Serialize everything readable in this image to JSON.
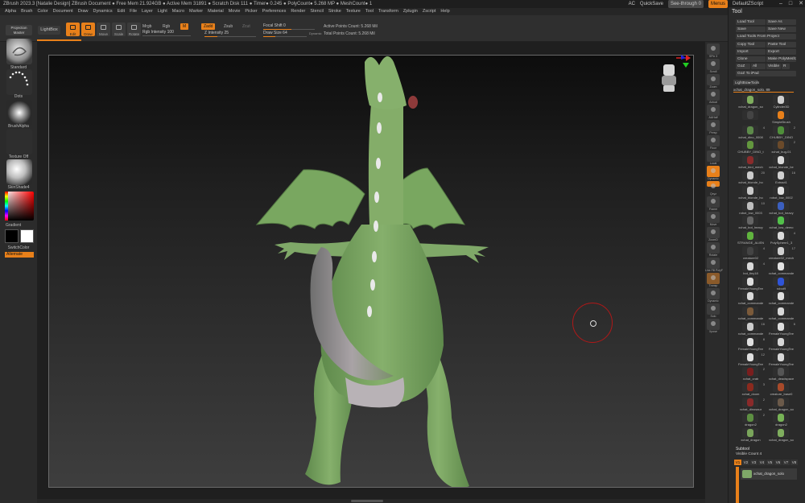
{
  "title_bar": {
    "title": "ZBrush 2023.3 [Natalie Design]   ZBrush Document     ● Free Mem 21.924GB ● Active Mem 31891 ● Scratch Disk 111 ● Timer● 0.245 ● PolyCount● 5.268 MP ● MeshCount● 1",
    "ac": "AC",
    "quicksave": "QuickSave",
    "see_through": "See-through  0",
    "menus": "Menus",
    "default_script": "DefaultZScript",
    "minimize": "–",
    "maximize": "□",
    "close": "✕"
  },
  "menu_bar": [
    "Alpha",
    "Brush",
    "Color",
    "Document",
    "Draw",
    "Dynamics",
    "Edit",
    "File",
    "Layer",
    "Light",
    "Macro",
    "Marker",
    "Material",
    "Movie",
    "Picker",
    "Preferences",
    "Render",
    "Stencil",
    "Stroke",
    "Texture",
    "Tool",
    "Transform",
    "Zplugin",
    "Zscript",
    "Help"
  ],
  "top_shelf": {
    "lightbox": "LightBox",
    "buttons": [
      {
        "label": "Edit",
        "active": true,
        "icon": "edit-icon"
      },
      {
        "label": "Draw",
        "active": true,
        "icon": "draw-icon"
      },
      {
        "label": "Move",
        "active": false,
        "icon": "move-icon"
      },
      {
        "label": "Scale",
        "active": false,
        "icon": "scale-icon"
      },
      {
        "label": "Rotate",
        "active": false,
        "icon": "rotate-icon"
      }
    ],
    "mrgb": "Mrgb",
    "rgb": "Rgb",
    "m": "M",
    "rgb_intensity": "Rgb Intensity 100",
    "zadd": "Zadd",
    "zsub": "Zsub",
    "zcut": "Zcut",
    "z_intensity": "Z Intensity 25",
    "z_intensity_value": 25,
    "focal_shift": "Focal Shift 0",
    "draw_size": "Draw Size 64",
    "dynamic": "Dynamic",
    "active_points": "Active Points Count: 5.268 Mil",
    "total_points": "Total Points Count: 5.268 Mil"
  },
  "left_panel": {
    "projection_master": "Projection Master",
    "standard": "Standard",
    "dots": "Dots",
    "brush_alpha": "BrushAlpha",
    "texture_off": "Texture Off",
    "material": "SkinShade4",
    "gradient": "Gradient",
    "switch_color": "SwitchColor",
    "alternate": "Alternate"
  },
  "right_strip": [
    {
      "label": "SPix 3",
      "icon": "spix-icon"
    },
    {
      "label": "Scroll",
      "icon": "scroll-icon"
    },
    {
      "label": "Zoom",
      "icon": "zoom-icon"
    },
    {
      "label": "Actual",
      "icon": "actual-icon"
    },
    {
      "label": "AAHalf",
      "icon": "aahalf-icon"
    },
    {
      "label": "Persp",
      "icon": "persp-icon"
    },
    {
      "label": "Floor",
      "icon": "floor-icon"
    },
    {
      "label": "Local",
      "icon": "local-icon"
    },
    {
      "label": "Dynamic",
      "icon": "dynamic-icon"
    },
    {
      "label": "Qxyz",
      "icon": "xyz-icon"
    },
    {
      "label": "Frame",
      "icon": "frame-icon"
    },
    {
      "label": "Move",
      "icon": "move-view-icon"
    },
    {
      "label": "ZoomD",
      "icon": "zoomd-icon"
    },
    {
      "label": "Rotate",
      "icon": "rotate-view-icon"
    },
    {
      "label": "Line Fill PolyF",
      "icon": "polyframe-icon"
    },
    {
      "label": "Transp",
      "icon": "transp-icon"
    },
    {
      "label": "Dynamic",
      "icon": "dynamic-sub-icon"
    },
    {
      "label": "Solo",
      "icon": "solo-icon"
    },
    {
      "label": "Xpose",
      "icon": "xpose-icon"
    }
  ],
  "tool_panel": {
    "title": "Tool",
    "buttons": [
      [
        "Load Tool",
        "Save As"
      ],
      [
        "Save",
        "Save New"
      ],
      [
        "Load Tools From Project",
        ""
      ],
      [
        "Copy Tool",
        "Paste Tool"
      ],
      [
        "Import",
        "Export"
      ],
      [
        "Clone",
        "Make PolyMesh3D"
      ],
      [
        "GoZ",
        "All",
        "Visible",
        "R"
      ],
      [
        "GoZ To iPad",
        ""
      ]
    ],
    "lightbox_tools": "LightBox▸Tools",
    "current_tool": "xchat_dragon_solo. 89",
    "tools": [
      {
        "name": "xchat_dragon_so",
        "num": "",
        "color": "#7fae5e"
      },
      {
        "name": "Cylinder3D",
        "num": "",
        "color": "#cfcfcf"
      },
      {
        "name": "",
        "num": "",
        "color": "#444"
      },
      {
        "name": "SimpleBrush",
        "num": "",
        "color": "#e8801a"
      },
      {
        "name": "xchat_dino_0008",
        "num": "4",
        "color": "#5d8a4a"
      },
      {
        "name": "CHUBBY_DINO",
        "num": "2",
        "color": "#4f8f3a"
      },
      {
        "name": "CHUBBY_DINO_t",
        "num": "",
        "color": "#63973e"
      },
      {
        "name": "xchat_bug-01",
        "num": "2",
        "color": "#6b4a2a"
      },
      {
        "name": "xchat_bird_mech",
        "num": "",
        "color": "#8a2b2b"
      },
      {
        "name": "xchat_blonde_he",
        "num": "",
        "color": "#d9d9d9"
      },
      {
        "name": "xchat_blonde_ho",
        "num": "20",
        "color": "#cccccc"
      },
      {
        "name": "Extract1",
        "num": "16",
        "color": "#d0d0d0"
      },
      {
        "name": "xchat_blonde_ho",
        "num": "",
        "color": "#c9c9c9"
      },
      {
        "name": "robot_low_0002",
        "num": "",
        "color": "#e0e0e0"
      },
      {
        "name": "robot_low_0003",
        "num": "10",
        "color": "#bdbdbd"
      },
      {
        "name": "xchat_bot_heavy",
        "num": "",
        "color": "#3b5fbf"
      },
      {
        "name": "xchat_bot_heavy",
        "num": "",
        "color": "#666"
      },
      {
        "name": "xchat_low_demo",
        "num": "",
        "color": "#52c04a"
      },
      {
        "name": "STRANGE_ALIEN",
        "num": "",
        "color": "#60b43e"
      },
      {
        "name": "PolySphere1_3",
        "num": "4",
        "color": "#dadada"
      },
      {
        "name": "creature02",
        "num": "4",
        "color": "#444"
      },
      {
        "name": "creature02_mech",
        "num": "17",
        "color": "#cfcfcf"
      },
      {
        "name": "bot_tiny18",
        "num": "4",
        "color": "#d9d9d9"
      },
      {
        "name": "xchat_commande",
        "num": "",
        "color": "#e3e3e3"
      },
      {
        "name": "FemaleYoungTee",
        "num": "",
        "color": "#ddd"
      },
      {
        "name": "robot9",
        "num": "",
        "color": "#2f54d8"
      },
      {
        "name": "xchat_commande",
        "num": "",
        "color": "#d9d9d9"
      },
      {
        "name": "xchat_commande",
        "num": "",
        "color": "#e0e0e0"
      },
      {
        "name": "xchat_commande",
        "num": "",
        "color": "#7b5a3a"
      },
      {
        "name": "xchat_commande",
        "num": "",
        "color": "#d8d8d8"
      },
      {
        "name": "xchat_commande",
        "num": "16",
        "color": "#ccc"
      },
      {
        "name": "FemaleYoungTee",
        "num": "6",
        "color": "#ddd"
      },
      {
        "name": "FemaleYoungTee",
        "num": "8",
        "color": "#e0e0e0"
      },
      {
        "name": "FemaleYoungTee",
        "num": "",
        "color": "#d6d6d6"
      },
      {
        "name": "FemaleYoungTee",
        "num": "12",
        "color": "#e0e0e0"
      },
      {
        "name": "FemaleYoungTee",
        "num": "",
        "color": "#d8d8d8"
      },
      {
        "name": "xchat_crab",
        "num": "2",
        "color": "#7a1e1e"
      },
      {
        "name": "xchat_deadspace",
        "num": "",
        "color": "#555"
      },
      {
        "name": "xchat_doom",
        "num": "3",
        "color": "#8b2a1e"
      },
      {
        "name": "creature_base0",
        "num": "",
        "color": "#a84a2a"
      },
      {
        "name": "xchat_dinosaur",
        "num": "2",
        "color": "#8a2a2a"
      },
      {
        "name": "xchat_dragon_so",
        "num": "",
        "color": "#6b5a4a"
      },
      {
        "name": "dragon2",
        "num": "2",
        "color": "#5d8f42"
      },
      {
        "name": "dragon2",
        "num": "",
        "color": "#77b356"
      },
      {
        "name": "xchat_dragon",
        "num": "",
        "color": "#7aa55b"
      },
      {
        "name": "xchat_dragon_so",
        "num": "",
        "color": "#7fae5e"
      }
    ],
    "subtool": "Subtool",
    "visible_count": "Visible Count 4",
    "v_tabs": [
      "V1",
      "V2",
      "V3",
      "V4",
      "V5",
      "V6",
      "V7",
      "V8"
    ],
    "subtool_item": "xchat_dragon_solo"
  },
  "accent_color": "#e8801a",
  "model_color": "#7fa868"
}
